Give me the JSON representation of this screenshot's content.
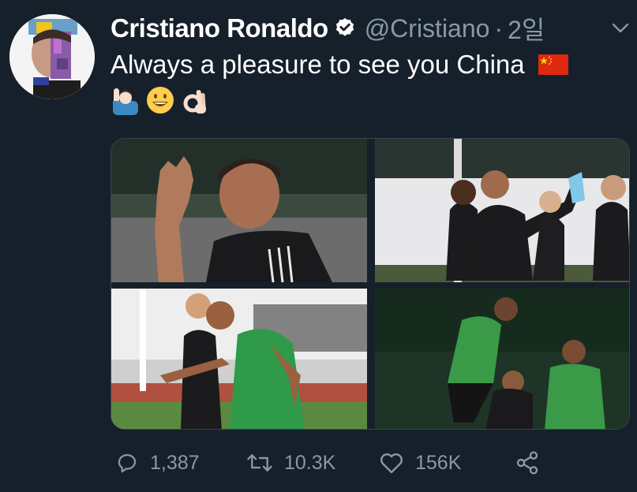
{
  "tweet": {
    "author_name": "Cristiano Ronaldo",
    "handle": "@Cristiano",
    "separator": "·",
    "time": "2일",
    "text": "Always a pleasure to see you China",
    "flag_icon": "china-flag-icon",
    "emojis": [
      "man-raising-hand-icon",
      "grinning-face-icon",
      "ok-hand-icon"
    ],
    "verified_icon": "verified-badge-icon",
    "menu_icon": "chevron-down-icon"
  },
  "media": {
    "photos": [
      "photo-waving",
      "photo-high-kick",
      "photo-duel",
      "photo-training-group"
    ]
  },
  "actions": {
    "reply": {
      "icon": "reply-icon",
      "count": "1,387"
    },
    "retweet": {
      "icon": "retweet-icon",
      "count": "10.3K"
    },
    "like": {
      "icon": "heart-icon",
      "count": "156K"
    },
    "share": {
      "icon": "share-icon"
    }
  },
  "colors": {
    "background": "#15202b",
    "muted": "#8899a6",
    "text": "#ffffff",
    "verified_badge": "#ffffff"
  }
}
